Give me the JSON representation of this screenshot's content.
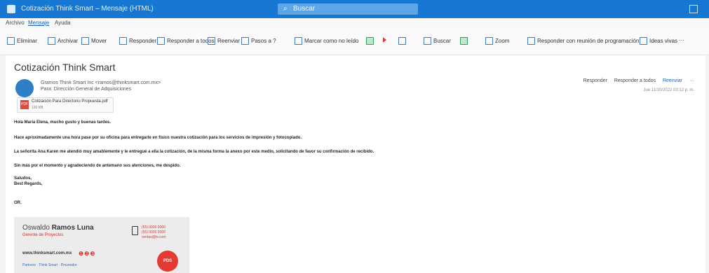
{
  "window": {
    "title": "Cotización Think Smart – Mensaje (HTML)",
    "search_placeholder": "Buscar"
  },
  "menubar": [
    "Archivo",
    "Mensaje",
    "Ayuda"
  ],
  "ribbon": [
    {
      "label": "Eliminar",
      "icon": "trash-icon"
    },
    {
      "label": "Archivar",
      "icon": "archive-icon"
    },
    {
      "label": "Mover",
      "icon": "move-icon"
    },
    {
      "label": "Responder",
      "icon": "reply-icon"
    },
    {
      "label": "Responder a todos",
      "icon": "reply-all-icon"
    },
    {
      "label": "Reenviar",
      "icon": "forward-icon"
    },
    {
      "label": "Pasos a ?",
      "icon": "quick-steps-icon"
    },
    {
      "label": "Marcar como no leído",
      "icon": "mail-icon"
    },
    {
      "label": "",
      "icon": "categorize-icon"
    },
    {
      "label": "",
      "icon": "flag-icon"
    },
    {
      "label": "",
      "icon": "more-icon"
    },
    {
      "label": "Buscar",
      "icon": "search-icon"
    },
    {
      "label": "",
      "icon": "translate-icon"
    },
    {
      "label": "Zoom",
      "icon": "zoom-icon"
    },
    {
      "label": "Responder con reunión de programación",
      "icon": "calendar-icon"
    },
    {
      "label": "Ideas vivas",
      "icon": "ideas-icon"
    },
    {
      "label": "···",
      "icon": "ellipsis-icon"
    }
  ],
  "email": {
    "subject": "Cotización Think Smart",
    "from": "Gramos Think Smart Inc <ramos@thinksmart.com.mx>",
    "to": "Para: Dirección General de Adquisiciones",
    "date": "Jue 11/10/2022 03:12 p. m.",
    "actions": [
      "Responder",
      "Responder a todos",
      "Reenviar",
      "···"
    ],
    "attachment": {
      "name": "Cotización Para Directorio Propuesta.pdf",
      "size": "120 KB"
    },
    "body": [
      "Hola María Elena, mucho gusto y buenas tardes.",
      "Hace aproximadamente una hora pase por su oficina para entregarle en físico nuestra cotización para los servicios de impresión y fotocopiado.",
      "La señorita Ana Karen me atendió muy amablemente y le entregué a ella la cotización, de la misma forma la anexo por este medio, solicitando de favor su confirmación de recibido.",
      "Sin más por el momento y agradeciendo de antemano sus atenciones, me despido.",
      "Saludos,",
      "Best Regards,",
      "OR."
    ]
  },
  "signature": {
    "first_name": "Oswaldo",
    "last_name": "Ramos Luna",
    "role": "Gerente de Proyectos",
    "website": "www.thinksmart.com.mx",
    "social": "❶❷❸",
    "phones": [
      "(55) 0000 0000",
      "(55) 0000 0000",
      "ventas@ts.com"
    ],
    "badge": "PDS",
    "logos": "Partners · Think Smart · Proveedor"
  }
}
